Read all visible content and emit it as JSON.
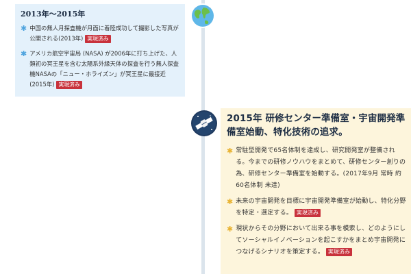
{
  "left_panel": {
    "range_title": "2013年～2015年",
    "items": [
      {
        "text": "中国の無人月探査機が月面に着陸成功して撮影した写真が公開される(2013年)",
        "badge": "実現済み"
      },
      {
        "text": "アメリカ航空宇宙局 (NASA) が2006年に打ち上げた、人類初の冥王星を含む太陽系外縁天体の探査を行う無人探査機NASAの「ニュー・ホライズン」が冥王星に最接近(2015年)",
        "badge": "実現済み"
      }
    ]
  },
  "right_panel": {
    "heading": "2015年 研修センター準備室・宇宙開発準備室始動、特化技術の追求。",
    "items": [
      {
        "text": "常駐型開発で65名体制を達成し、研究開発室が整備される。今までの研修ノウハウをまとめて、研修センター創りの為、研修センター準備室を始動する。(2017年9月 常時 約60名体制 未達)",
        "badge": ""
      },
      {
        "text": "未来の宇宙開発を目標に宇宙開発準備室が始動し、特化分野を特定・選定する。",
        "badge": "実現済み"
      },
      {
        "text": "現状からその分野において出来る事を模索し、どのようにしてソーシャルイノベーションを起こすかをまとめ宇宙開発につなげるシナリオを策定する。",
        "badge": "実現済み"
      }
    ]
  },
  "colors": {
    "left_bg": "#e4f1fb",
    "right_bg": "#fdf5dc",
    "badge": "#c8323c",
    "left_bullet": "#4ea3de",
    "right_bullet": "#e8b230",
    "timeline": "#dbe4ec"
  },
  "icons": {
    "left_marker": "globe-icon",
    "right_marker": "satellite-icon"
  }
}
